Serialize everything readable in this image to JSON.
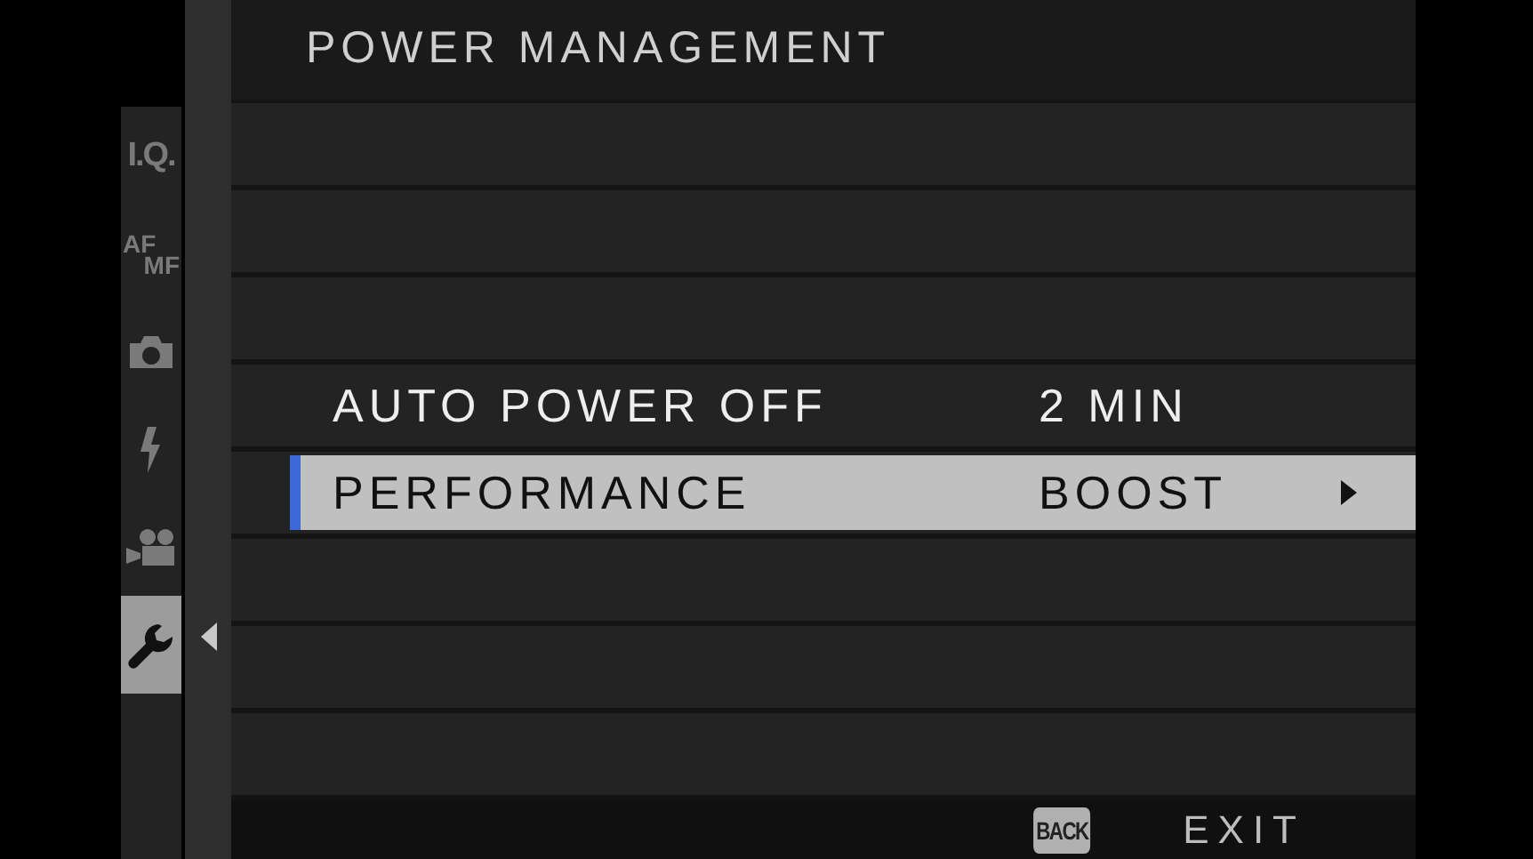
{
  "title": "POWER MANAGEMENT",
  "side_tabs": [
    {
      "kind": "text",
      "label": "I.Q.",
      "selected": false
    },
    {
      "kind": "stack",
      "label": "AF",
      "label_2": "MF",
      "selected": false
    },
    {
      "kind": "camera",
      "selected": false
    },
    {
      "kind": "flash",
      "selected": false
    },
    {
      "kind": "movie",
      "selected": false
    },
    {
      "kind": "wrench",
      "selected": true
    }
  ],
  "rows": [
    {
      "kind": "blank"
    },
    {
      "kind": "blank"
    },
    {
      "kind": "blank"
    },
    {
      "kind": "item",
      "label": "AUTO POWER OFF",
      "value": "2 MIN",
      "selected": false,
      "submenu": false
    },
    {
      "kind": "item",
      "label": "PERFORMANCE",
      "value": "BOOST",
      "selected": true,
      "submenu": true
    },
    {
      "kind": "blank"
    },
    {
      "kind": "blank"
    },
    {
      "kind": "blank"
    }
  ],
  "footer": {
    "back_key": "BACK",
    "action": "EXIT"
  }
}
